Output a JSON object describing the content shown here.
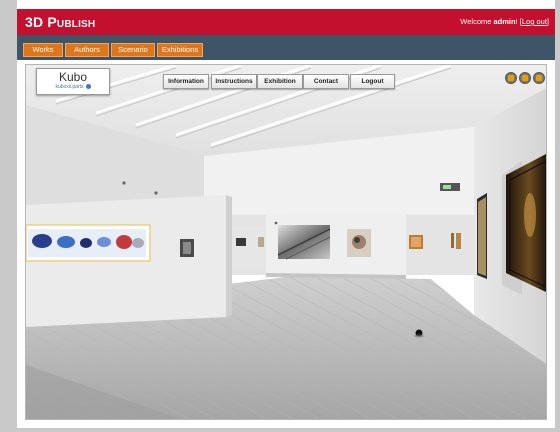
{
  "header": {
    "brand": "3D Publish",
    "welcome_prefix": "Welcome ",
    "username": "admin",
    "sep_open": "! [",
    "logout_label": "Log out",
    "sep_close": "]"
  },
  "nav": {
    "tabs": [
      "Works",
      "Authors",
      "Scenario",
      "Exhibitions"
    ]
  },
  "viewer": {
    "logo_title": "Kubo",
    "logo_sub": "kuboxii.parts",
    "menu": [
      "Information",
      "Instructions",
      "Exhibition",
      "Contact",
      "Logout"
    ],
    "controls": [
      "minimize-control-icon",
      "window-control-icon",
      "close-control-icon"
    ]
  },
  "colors": {
    "header_red": "#c4102f",
    "nav_slate": "#3d5566",
    "tab_orange": "#e0761b",
    "control_accent": "#e6a100"
  }
}
